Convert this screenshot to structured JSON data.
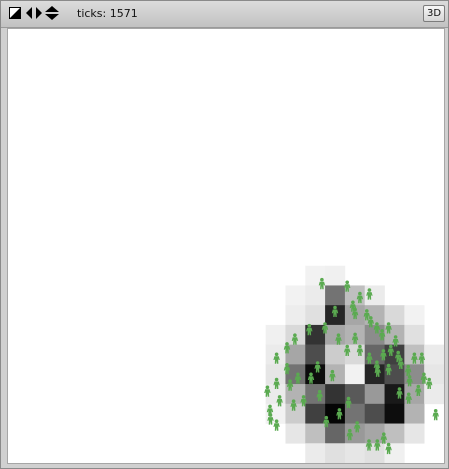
{
  "toolbar": {
    "icons": [
      "size-toggle-icon",
      "move-left-right-icon",
      "move-up-down-icon"
    ],
    "ticks_label": "ticks: 1571",
    "three_d_label": "3D"
  },
  "world": {
    "background": "#ffffff",
    "turtle_color": "#5aaa50",
    "grid_cols": 22,
    "grid_rows": 22,
    "patch_shading": [
      {
        "c": 15,
        "r": 12,
        "g": 0.05
      },
      {
        "c": 16,
        "r": 12,
        "g": 0.06
      },
      {
        "c": 14,
        "r": 13,
        "g": 0.05
      },
      {
        "c": 15,
        "r": 13,
        "g": 0.08
      },
      {
        "c": 16,
        "r": 13,
        "g": 0.55
      },
      {
        "c": 17,
        "r": 13,
        "g": 0.25
      },
      {
        "c": 18,
        "r": 13,
        "g": 0.08
      },
      {
        "c": 14,
        "r": 14,
        "g": 0.07
      },
      {
        "c": 15,
        "r": 14,
        "g": 0.12
      },
      {
        "c": 16,
        "r": 14,
        "g": 0.85
      },
      {
        "c": 17,
        "r": 14,
        "g": 0.35
      },
      {
        "c": 18,
        "r": 14,
        "g": 0.3
      },
      {
        "c": 19,
        "r": 14,
        "g": 0.15
      },
      {
        "c": 20,
        "r": 14,
        "g": 0.05
      },
      {
        "c": 13,
        "r": 15,
        "g": 0.06
      },
      {
        "c": 14,
        "r": 15,
        "g": 0.15
      },
      {
        "c": 15,
        "r": 15,
        "g": 0.8
      },
      {
        "c": 16,
        "r": 15,
        "g": 0.35
      },
      {
        "c": 17,
        "r": 15,
        "g": 0.3
      },
      {
        "c": 18,
        "r": 15,
        "g": 0.45
      },
      {
        "c": 19,
        "r": 15,
        "g": 0.3
      },
      {
        "c": 20,
        "r": 15,
        "g": 0.12
      },
      {
        "c": 13,
        "r": 16,
        "g": 0.08
      },
      {
        "c": 14,
        "r": 16,
        "g": 0.35
      },
      {
        "c": 15,
        "r": 16,
        "g": 0.7
      },
      {
        "c": 16,
        "r": 16,
        "g": 0.2
      },
      {
        "c": 17,
        "r": 16,
        "g": 0.15
      },
      {
        "c": 18,
        "r": 16,
        "g": 0.6
      },
      {
        "c": 19,
        "r": 16,
        "g": 0.75
      },
      {
        "c": 20,
        "r": 16,
        "g": 0.25
      },
      {
        "c": 21,
        "r": 16,
        "g": 0.08
      },
      {
        "c": 13,
        "r": 17,
        "g": 0.1
      },
      {
        "c": 14,
        "r": 17,
        "g": 0.55
      },
      {
        "c": 15,
        "r": 17,
        "g": 0.95
      },
      {
        "c": 16,
        "r": 17,
        "g": 0.3
      },
      {
        "c": 17,
        "r": 17,
        "g": 0.05
      },
      {
        "c": 18,
        "r": 17,
        "g": 0.85
      },
      {
        "c": 19,
        "r": 17,
        "g": 0.7
      },
      {
        "c": 20,
        "r": 17,
        "g": 0.45
      },
      {
        "c": 21,
        "r": 17,
        "g": 0.1
      },
      {
        "c": 13,
        "r": 18,
        "g": 0.08
      },
      {
        "c": 14,
        "r": 18,
        "g": 0.3
      },
      {
        "c": 15,
        "r": 18,
        "g": 0.55
      },
      {
        "c": 16,
        "r": 18,
        "g": 0.8
      },
      {
        "c": 17,
        "r": 18,
        "g": 0.65
      },
      {
        "c": 18,
        "r": 18,
        "g": 0.4
      },
      {
        "c": 19,
        "r": 18,
        "g": 0.9
      },
      {
        "c": 20,
        "r": 18,
        "g": 0.35
      },
      {
        "c": 21,
        "r": 18,
        "g": 0.08
      },
      {
        "c": 13,
        "r": 19,
        "g": 0.05
      },
      {
        "c": 14,
        "r": 19,
        "g": 0.2
      },
      {
        "c": 15,
        "r": 19,
        "g": 0.75
      },
      {
        "c": 16,
        "r": 19,
        "g": 0.98
      },
      {
        "c": 17,
        "r": 19,
        "g": 0.55
      },
      {
        "c": 18,
        "r": 19,
        "g": 0.7
      },
      {
        "c": 19,
        "r": 19,
        "g": 0.95
      },
      {
        "c": 20,
        "r": 19,
        "g": 0.3
      },
      {
        "c": 14,
        "r": 20,
        "g": 0.1
      },
      {
        "c": 15,
        "r": 20,
        "g": 0.25
      },
      {
        "c": 16,
        "r": 20,
        "g": 0.6
      },
      {
        "c": 17,
        "r": 20,
        "g": 0.4
      },
      {
        "c": 18,
        "r": 20,
        "g": 0.35
      },
      {
        "c": 19,
        "r": 20,
        "g": 0.25
      },
      {
        "c": 20,
        "r": 20,
        "g": 0.1
      },
      {
        "c": 15,
        "r": 21,
        "g": 0.08
      },
      {
        "c": 16,
        "r": 21,
        "g": 0.12
      },
      {
        "c": 17,
        "r": 21,
        "g": 0.1
      },
      {
        "c": 18,
        "r": 21,
        "g": 0.12
      },
      {
        "c": 19,
        "r": 21,
        "g": 0.06
      }
    ],
    "turtles": [
      [
        0.72,
        0.588
      ],
      [
        0.778,
        0.594
      ],
      [
        0.791,
        0.64
      ],
      [
        0.807,
        0.62
      ],
      [
        0.829,
        0.612
      ],
      [
        0.796,
        0.657
      ],
      [
        0.75,
        0.652
      ],
      [
        0.823,
        0.66
      ],
      [
        0.832,
        0.676
      ],
      [
        0.846,
        0.69
      ],
      [
        0.858,
        0.706
      ],
      [
        0.873,
        0.69
      ],
      [
        0.889,
        0.72
      ],
      [
        0.861,
        0.752
      ],
      [
        0.878,
        0.742
      ],
      [
        0.895,
        0.756
      ],
      [
        0.901,
        0.772
      ],
      [
        0.918,
        0.788
      ],
      [
        0.932,
        0.76
      ],
      [
        0.949,
        0.76
      ],
      [
        0.966,
        0.818
      ],
      [
        0.954,
        0.806
      ],
      [
        0.921,
        0.812
      ],
      [
        0.941,
        0.834
      ],
      [
        0.873,
        0.786
      ],
      [
        0.846,
        0.778
      ],
      [
        0.829,
        0.76
      ],
      [
        0.807,
        0.742
      ],
      [
        0.778,
        0.742
      ],
      [
        0.796,
        0.714
      ],
      [
        0.758,
        0.716
      ],
      [
        0.727,
        0.69
      ],
      [
        0.691,
        0.694
      ],
      [
        0.658,
        0.716
      ],
      [
        0.64,
        0.736
      ],
      [
        0.616,
        0.76
      ],
      [
        0.64,
        0.784
      ],
      [
        0.665,
        0.806
      ],
      [
        0.647,
        0.822
      ],
      [
        0.616,
        0.818
      ],
      [
        0.595,
        0.836
      ],
      [
        0.623,
        0.858
      ],
      [
        0.601,
        0.88
      ],
      [
        0.655,
        0.868
      ],
      [
        0.678,
        0.858
      ],
      [
        0.602,
        0.9
      ],
      [
        0.616,
        0.914
      ],
      [
        0.715,
        0.846
      ],
      [
        0.744,
        0.8
      ],
      [
        0.781,
        0.862
      ],
      [
        0.801,
        0.918
      ],
      [
        0.828,
        0.96
      ],
      [
        0.847,
        0.96
      ],
      [
        0.862,
        0.944
      ],
      [
        0.873,
        0.968
      ],
      [
        0.784,
        0.936
      ],
      [
        0.73,
        0.906
      ],
      [
        0.76,
        0.888
      ],
      [
        0.695,
        0.806
      ],
      [
        0.71,
        0.78
      ],
      [
        0.898,
        0.84
      ],
      [
        0.919,
        0.852
      ],
      [
        0.981,
        0.89
      ],
      [
        0.848,
        0.79
      ]
    ]
  }
}
